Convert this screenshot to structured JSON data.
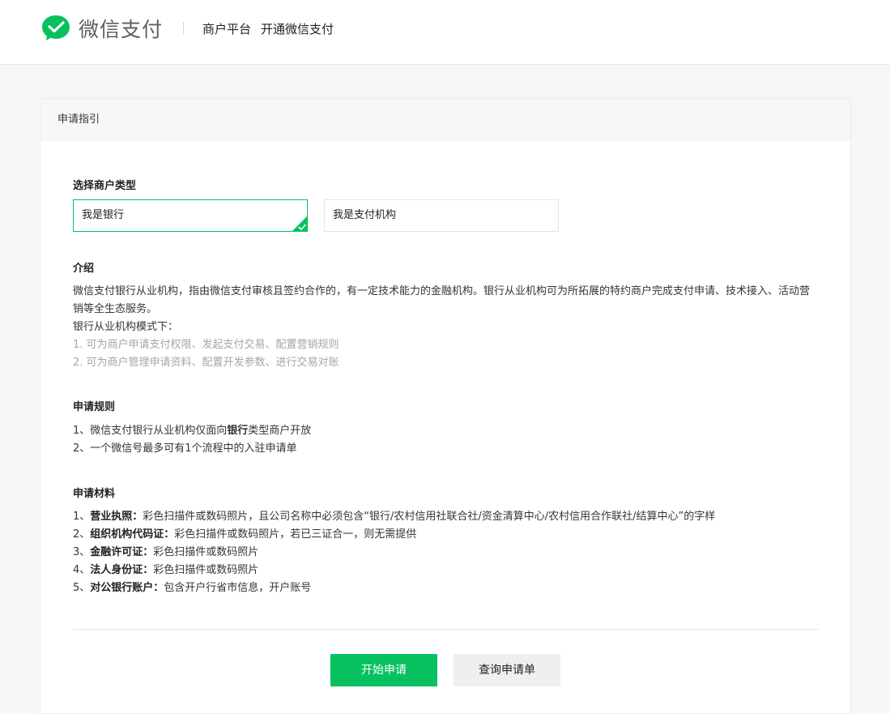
{
  "header": {
    "brand": "微信支付",
    "nav": [
      "商户平台",
      "开通微信支付"
    ]
  },
  "panel": {
    "title": "申请指引"
  },
  "merchant_type": {
    "title": "选择商户类型",
    "options": [
      "我是银行",
      "我是支付机构"
    ],
    "selected": "我是银行"
  },
  "intro": {
    "title": "介绍",
    "paragraph": "微信支付银行从业机构，指由微信支付审核且签约合作的，有一定技术能力的金融机构。银行从业机构可为所拓展的特约商户完成支付申请、技术接入、活动营销等全生态服务。",
    "mode_label": "银行从业机构模式下：",
    "items": [
      "1. 可为商户申请支付权限、发起支付交易、配置营销规则",
      "2. 可为商户管理申请资料、配置开发参数、进行交易对账"
    ]
  },
  "rules": {
    "title": "申请规则",
    "rule1_prefix": "1、微信支付银行从业机构仅面向",
    "rule1_bold": "银行",
    "rule1_suffix": "类型商户开放",
    "rule2": "2、一个微信号最多可有1个流程中的入驻申请单"
  },
  "materials": {
    "title": "申请材料",
    "items": [
      {
        "num": "1、",
        "label": "营业执照：",
        "text": "彩色扫描件或数码照片，且公司名称中必须包含“银行/农村信用社联合社/资金清算中心/农村信用合作联社/结算中心”的字样"
      },
      {
        "num": "2、",
        "label": "组织机构代码证：",
        "text": "彩色扫描件或数码照片，若已三证合一，则无需提供"
      },
      {
        "num": "3、",
        "label": "金融许可证：",
        "text": "彩色扫描件或数码照片"
      },
      {
        "num": "4、",
        "label": "法人身份证：",
        "text": "彩色扫描件或数码照片"
      },
      {
        "num": "5、",
        "label": "对公银行账户：",
        "text": "包含开户行省市信息，开户账号"
      }
    ]
  },
  "actions": {
    "start": "开始申请",
    "query": "查询申请单"
  },
  "colors": {
    "accent": "#07c160",
    "muted": "#a6a6a6"
  }
}
